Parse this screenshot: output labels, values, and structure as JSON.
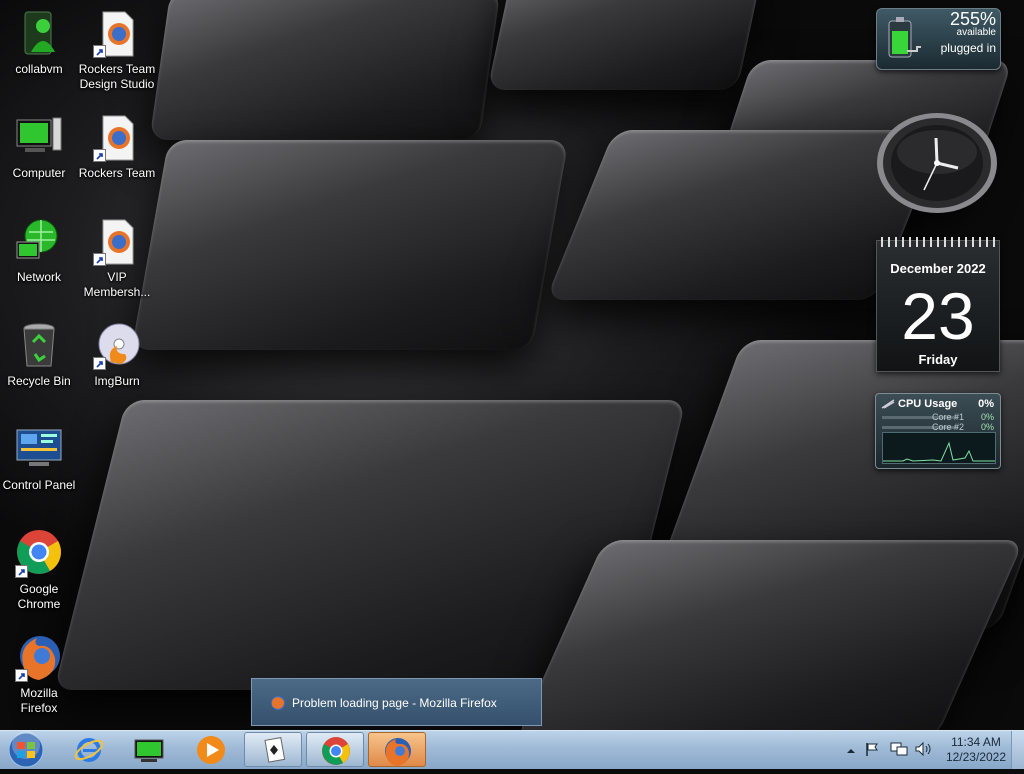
{
  "desktop": {
    "icons": [
      {
        "name": "collabvm"
      },
      {
        "name": "Rockers Team\nDesign Studio"
      },
      {
        "name": "Computer"
      },
      {
        "name": "Rockers Team"
      },
      {
        "name": "Network"
      },
      {
        "name": "VIP\nMembersh..."
      },
      {
        "name": "Recycle Bin"
      },
      {
        "name": "ImgBurn"
      },
      {
        "name": "Control Panel"
      },
      {
        "name": "Google\nChrome"
      },
      {
        "name": "Mozilla\nFirefox"
      }
    ]
  },
  "gadgets": {
    "battery": {
      "percent": "255%",
      "available": "available",
      "status": "plugged in"
    },
    "calendar": {
      "month": "December 2022",
      "day": "23",
      "weekday": "Friday"
    },
    "cpu": {
      "title": "CPU Usage",
      "value": "0%",
      "cores": [
        {
          "label": "Core #1",
          "value": "0%"
        },
        {
          "label": "Core #2",
          "value": "0%"
        }
      ]
    }
  },
  "notification": {
    "text": "Problem loading page - Mozilla Firefox"
  },
  "taskbar": {
    "clock": {
      "time": "11:34 AM",
      "date": "12/23/2022"
    }
  },
  "colors": {
    "taskbar": "#9fbad6",
    "popup": "#3f5d7a",
    "active_task": "#e8955a"
  }
}
